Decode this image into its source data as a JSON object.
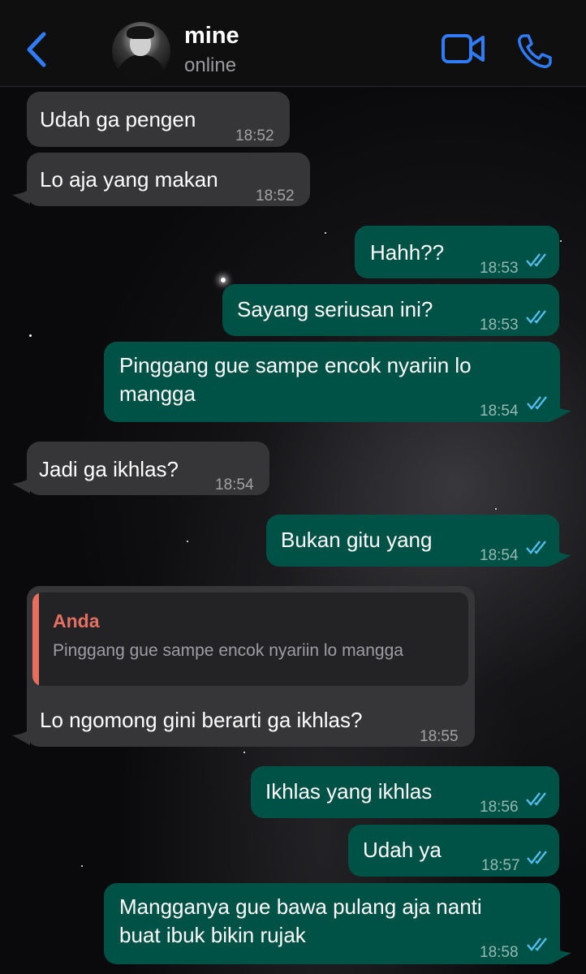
{
  "header": {
    "back_icon": "chevron-left-icon",
    "contact_name": "mine",
    "contact_status": "online",
    "video_icon": "video-camera-icon",
    "call_icon": "phone-icon",
    "accent": "#2f7cf6"
  },
  "messages": [
    {
      "dir": "in",
      "text": "Udah ga pengen",
      "time": "18:52"
    },
    {
      "dir": "in",
      "text": "Lo aja yang makan",
      "time": "18:52"
    },
    {
      "dir": "out",
      "text": "Hahh??",
      "time": "18:53",
      "read": true
    },
    {
      "dir": "out",
      "text": "Sayang seriusan ini?",
      "time": "18:53",
      "read": true
    },
    {
      "dir": "out",
      "text": "Pinggang gue sampe encok nyariin lo\nmangga",
      "time": "18:54",
      "read": true
    },
    {
      "dir": "in",
      "text": "Jadi ga ikhlas?",
      "time": "18:54"
    },
    {
      "dir": "out",
      "text": "Bukan gitu yang",
      "time": "18:54",
      "read": true
    },
    {
      "dir": "in",
      "text": "Lo ngomong gini berarti ga ikhlas?",
      "time": "18:55",
      "reply": {
        "author": "Anda",
        "text": "Pinggang gue sampe encok nyariin lo mangga"
      }
    },
    {
      "dir": "out",
      "text": "Ikhlas yang ikhlas",
      "time": "18:56",
      "read": true
    },
    {
      "dir": "out",
      "text": "Udah ya",
      "time": "18:57",
      "read": true
    },
    {
      "dir": "out",
      "text": "Mangganya gue bawa pulang aja nanti\nbuat ibuk bikin rujak",
      "time": "18:58",
      "read": true
    }
  ],
  "colors": {
    "incoming_bubble": "#363638",
    "outgoing_bubble": "#005146",
    "read_ticks": "#53bdeb",
    "reply_accent": "#e57062"
  }
}
